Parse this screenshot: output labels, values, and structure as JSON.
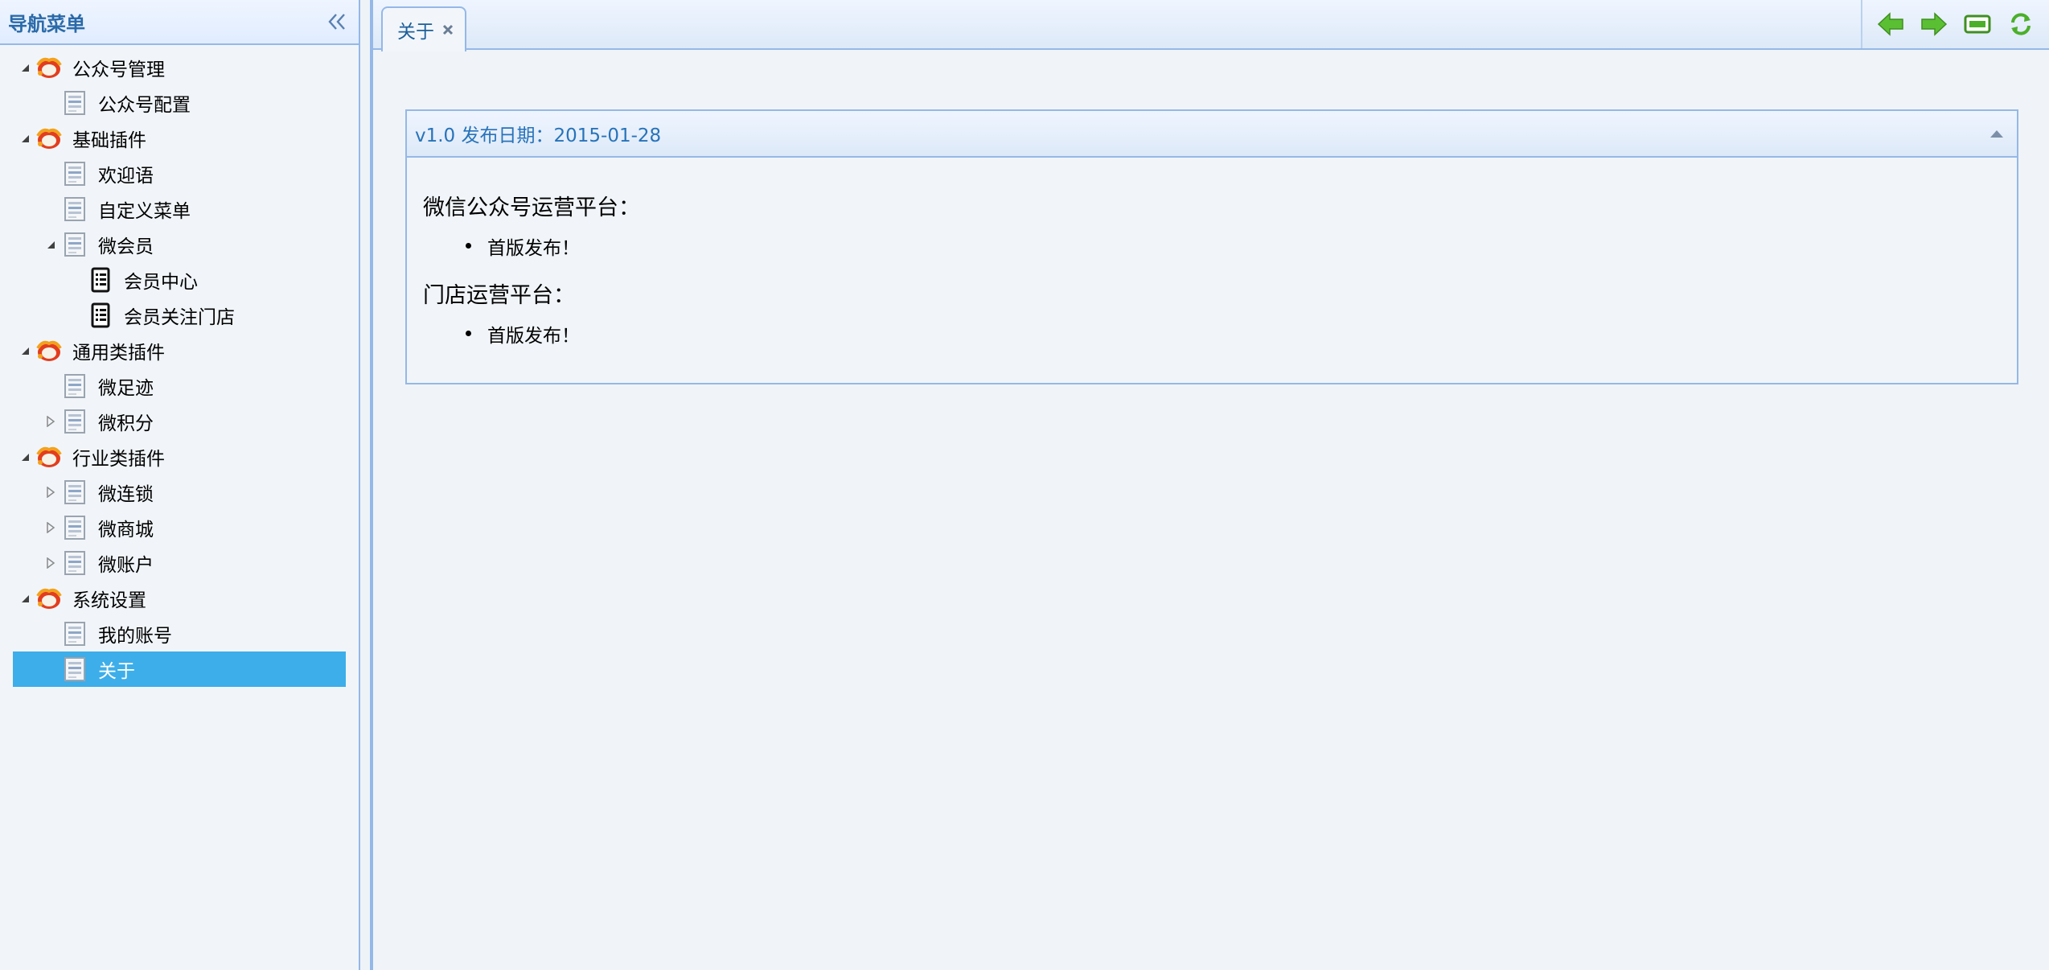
{
  "sidebar": {
    "title": "导航菜单",
    "tree": [
      {
        "label": "公众号管理",
        "level": 0,
        "toggle": "expanded",
        "icon": "folder-flame-icon"
      },
      {
        "label": "公众号配置",
        "level": 1,
        "toggle": "none",
        "icon": "page-icon"
      },
      {
        "label": "基础插件",
        "level": 0,
        "toggle": "expanded",
        "icon": "folder-flame-icon"
      },
      {
        "label": "欢迎语",
        "level": 1,
        "toggle": "none",
        "icon": "page-icon"
      },
      {
        "label": "自定义菜单",
        "level": 1,
        "toggle": "none",
        "icon": "page-icon"
      },
      {
        "label": "微会员",
        "level": 1,
        "toggle": "expanded",
        "icon": "page-icon"
      },
      {
        "label": "会员中心",
        "level": 2,
        "toggle": "none",
        "icon": "list-icon"
      },
      {
        "label": "会员关注门店",
        "level": 2,
        "toggle": "none",
        "icon": "list-icon"
      },
      {
        "label": "通用类插件",
        "level": 0,
        "toggle": "expanded",
        "icon": "folder-flame-icon"
      },
      {
        "label": "微足迹",
        "level": 1,
        "toggle": "none",
        "icon": "page-icon"
      },
      {
        "label": "微积分",
        "level": 1,
        "toggle": "collapsed",
        "icon": "page-icon"
      },
      {
        "label": "行业类插件",
        "level": 0,
        "toggle": "expanded",
        "icon": "folder-flame-icon"
      },
      {
        "label": "微连锁",
        "level": 1,
        "toggle": "collapsed",
        "icon": "page-icon"
      },
      {
        "label": "微商城",
        "level": 1,
        "toggle": "collapsed",
        "icon": "page-icon"
      },
      {
        "label": "微账户",
        "level": 1,
        "toggle": "collapsed",
        "icon": "page-icon"
      },
      {
        "label": "系统设置",
        "level": 0,
        "toggle": "expanded",
        "icon": "folder-flame-icon"
      },
      {
        "label": "我的账号",
        "level": 1,
        "toggle": "none",
        "icon": "page-icon"
      },
      {
        "label": "关于",
        "level": 1,
        "toggle": "none",
        "icon": "page-icon",
        "selected": true
      }
    ]
  },
  "tabs": {
    "active_label": "关于"
  },
  "panel": {
    "title": "v1.0 发布日期：2015-01-28",
    "sections": [
      {
        "heading": "微信公众号运营平台：",
        "items": [
          "首版发布！"
        ]
      },
      {
        "heading": "门店运营平台：",
        "items": [
          "首版发布！"
        ]
      }
    ]
  },
  "colors": {
    "border": "#95b8e7",
    "selected_bg": "#3daee9",
    "accent_text": "#2773b9",
    "tool_green": "#4caf2a"
  }
}
